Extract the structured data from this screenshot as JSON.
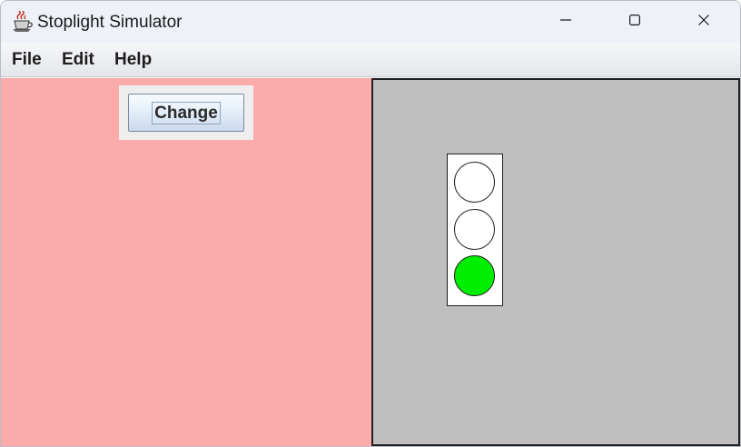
{
  "window": {
    "title": "Stoplight Simulator",
    "icon": "java-coffee-icon"
  },
  "titlebar_controls": {
    "minimize_icon": "minimize-icon",
    "maximize_icon": "maximize-icon",
    "close_icon": "close-icon"
  },
  "menu": {
    "items": [
      {
        "label": "File"
      },
      {
        "label": "Edit"
      },
      {
        "label": "Help"
      }
    ]
  },
  "controls": {
    "change_label": "Change"
  },
  "colors": {
    "left_panel_bg": "#fcabab",
    "right_panel_bg": "#bfbfbf",
    "light_off": "#ffffff",
    "light_green_on": "#00ee00"
  },
  "stoplight": {
    "active_light": "green",
    "lights": [
      {
        "position": "top",
        "state": "off",
        "color": "#ffffff"
      },
      {
        "position": "middle",
        "state": "off",
        "color": "#ffffff"
      },
      {
        "position": "bottom",
        "state": "on",
        "color": "#00ee00"
      }
    ]
  }
}
